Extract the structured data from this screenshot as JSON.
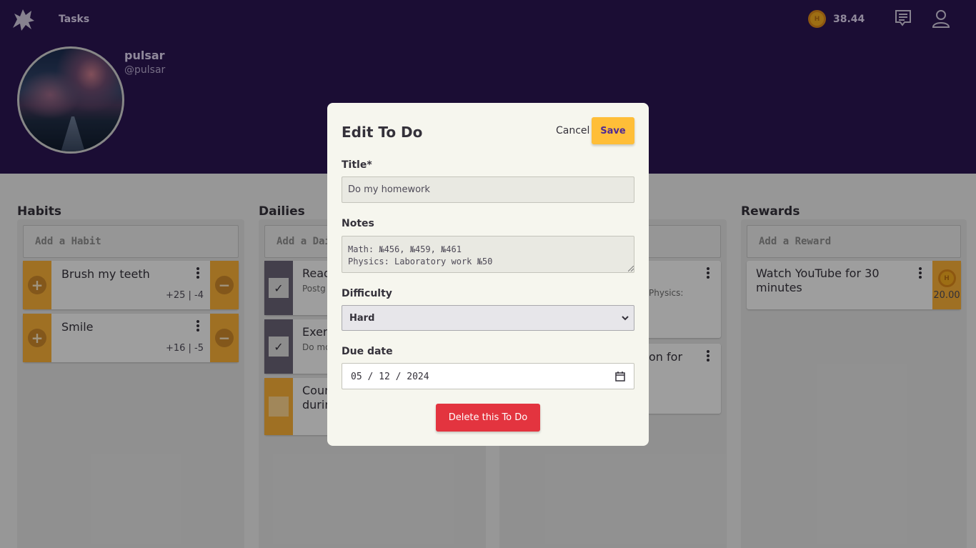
{
  "nav": {
    "tasks": "Tasks",
    "gold": "38.44"
  },
  "profile": {
    "name": "pulsar",
    "username": "@pulsar"
  },
  "habits": {
    "title": "Habits",
    "placeholder": "Add a Habit",
    "items": [
      {
        "text": "Brush my teeth",
        "score": "+25 | -4"
      },
      {
        "text": "Smile",
        "score": "+16 | -5"
      }
    ]
  },
  "dailies": {
    "title": "Dailies",
    "placeholder": "Add a Dai",
    "items": [
      {
        "text": "Read",
        "note": "Postg"
      },
      {
        "text": "Exerc",
        "note": "Do mo"
      },
      {
        "text": "Coun",
        "text2": "durin"
      }
    ]
  },
  "todos": {
    "items": [
      {
        "note": "Physics:"
      },
      {
        "text": "on for"
      }
    ]
  },
  "rewards": {
    "title": "Rewards",
    "placeholder": "Add a Reward",
    "items": [
      {
        "text": "Watch YouTube for 30 minutes",
        "cost": "20.00"
      }
    ]
  },
  "modal": {
    "title": "Edit To Do",
    "cancel": "Cancel",
    "save": "Save",
    "title_label": "Title*",
    "title_value": "Do my homework",
    "notes_label": "Notes",
    "notes_value": "Math: №456, №459, №461\nPhysics: Laboratory work №50",
    "difficulty_label": "Difficulty",
    "difficulty_value": "Hard",
    "due_label": "Due date",
    "due_value": "05 / 12 / 2024",
    "delete": "Delete this To Do"
  },
  "colors": {
    "header": "#2a1451",
    "accent": "#ffbe38",
    "danger": "#e3343f",
    "habit": "#f4ad36"
  }
}
